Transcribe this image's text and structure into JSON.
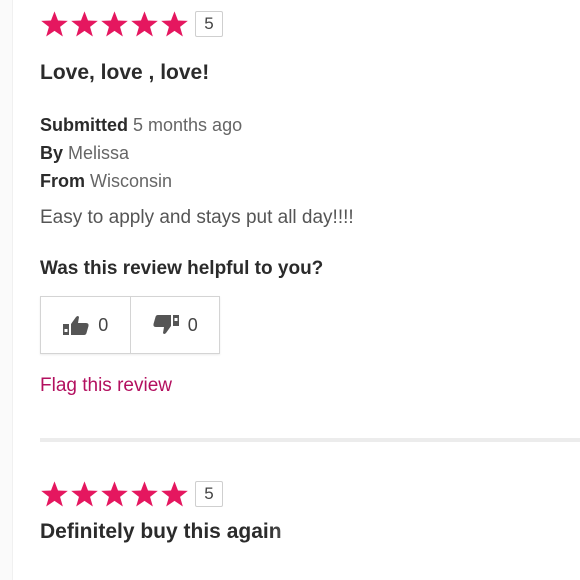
{
  "colors": {
    "star": "#e5175f",
    "flag_link": "#b3105f",
    "divider": "#ececec"
  },
  "reviews": [
    {
      "rating": 5,
      "rating_label": "5",
      "title": "Love, love , love!",
      "submitted_label": "Submitted",
      "submitted_value": "5 months ago",
      "by_label": "By",
      "by_value": "Melissa",
      "from_label": "From",
      "from_value": "Wisconsin",
      "body": "Easy to apply and stays put all day!!!!",
      "helpful_question": "Was this review helpful to you?",
      "helpful_yes_icon": "thumbs-up-icon",
      "helpful_yes_count": "0",
      "helpful_no_icon": "thumbs-down-icon",
      "helpful_no_count": "0",
      "flag_label": "Flag this review"
    },
    {
      "rating": 5,
      "rating_label": "5",
      "title": "Definitely buy this again"
    }
  ]
}
